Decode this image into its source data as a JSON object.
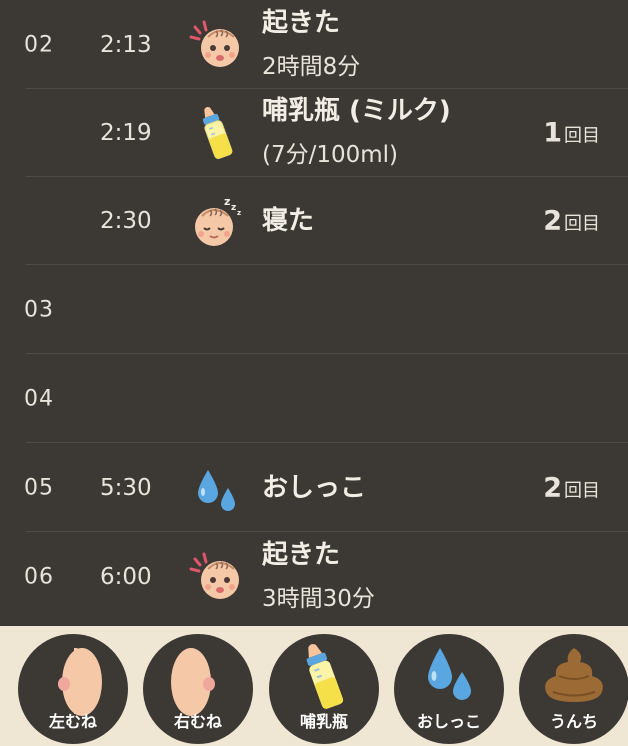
{
  "log": [
    {
      "hour": "02",
      "time": "2:13",
      "icon": "baby-awake-icon",
      "title": "起きた",
      "sub": "2時間8分",
      "count": "",
      "unit": ""
    },
    {
      "hour": "",
      "time": "2:19",
      "icon": "baby-bottle-icon",
      "title": "哺乳瓶 (ミルク)",
      "sub": "(7分/100ml)",
      "count": "1",
      "unit": "回目"
    },
    {
      "hour": "",
      "time": "2:30",
      "icon": "baby-sleeping-icon",
      "title": "寝た",
      "sub": "",
      "count": "2",
      "unit": "回目"
    },
    {
      "hour": "03",
      "time": "",
      "icon": "",
      "title": "",
      "sub": "",
      "count": "",
      "unit": ""
    },
    {
      "hour": "04",
      "time": "",
      "icon": "",
      "title": "",
      "sub": "",
      "count": "",
      "unit": ""
    },
    {
      "hour": "05",
      "time": "5:30",
      "icon": "pee-drops-icon",
      "title": "おしっこ",
      "sub": "",
      "count": "2",
      "unit": "回目"
    },
    {
      "hour": "06",
      "time": "6:00",
      "icon": "baby-awake-icon",
      "title": "起きた",
      "sub": "3時間30分",
      "count": "",
      "unit": ""
    }
  ],
  "actions": [
    {
      "label": "左むね",
      "icon": "left-breast-icon"
    },
    {
      "label": "右むね",
      "icon": "right-breast-icon"
    },
    {
      "label": "哺乳瓶",
      "icon": "baby-bottle-icon"
    },
    {
      "label": "おしっこ",
      "icon": "pee-drops-icon"
    },
    {
      "label": "うんち",
      "icon": "poop-icon"
    }
  ],
  "colors": {
    "background": "#3c3834",
    "bottom_bar": "#efe6d4",
    "text": "#e8e4dc",
    "drop_blue": "#5aa6e0",
    "poop_brown": "#9c6a35"
  }
}
